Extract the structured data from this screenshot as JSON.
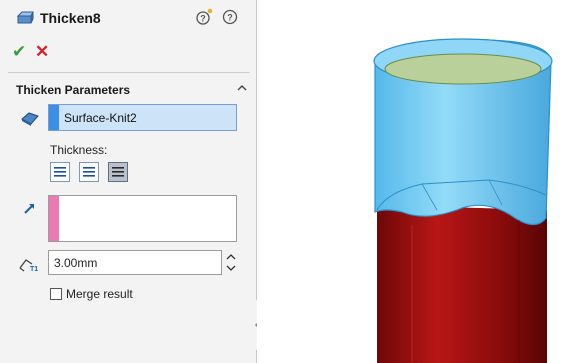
{
  "feature": {
    "title": "Thicken8",
    "icon": "thicken-feature-icon"
  },
  "header": {
    "help_icon": "whats-wrong-help-icon",
    "question_icon": "help-question-icon"
  },
  "actions": {
    "ok_symbol": "✔",
    "cancel_symbol": "✕"
  },
  "section": {
    "title": "Thicken Parameters",
    "collapse_icon": "chevron-up-icon"
  },
  "faces": {
    "value": "Surface-Knit2",
    "icon": "surface-selection-icon",
    "bar_color": "#3d8ee6"
  },
  "thickness": {
    "label": "Thickness:",
    "side_buttons": [
      "thicken-side-1-button",
      "thicken-both-sides-button",
      "thicken-side-2-button"
    ],
    "selected_index": 2
  },
  "second_selection": {
    "value": "",
    "icon": "direction-arrow-icon",
    "bar_color": "#e97bb2"
  },
  "thickness_value": {
    "value": "3.00mm",
    "icon": "thickness-t1-icon"
  },
  "merge": {
    "label": "Merge result",
    "checked": false
  },
  "model": {
    "shell_color": "#7fd0f4",
    "body_color": "#a01010",
    "inner_color": "#bcd39a"
  }
}
